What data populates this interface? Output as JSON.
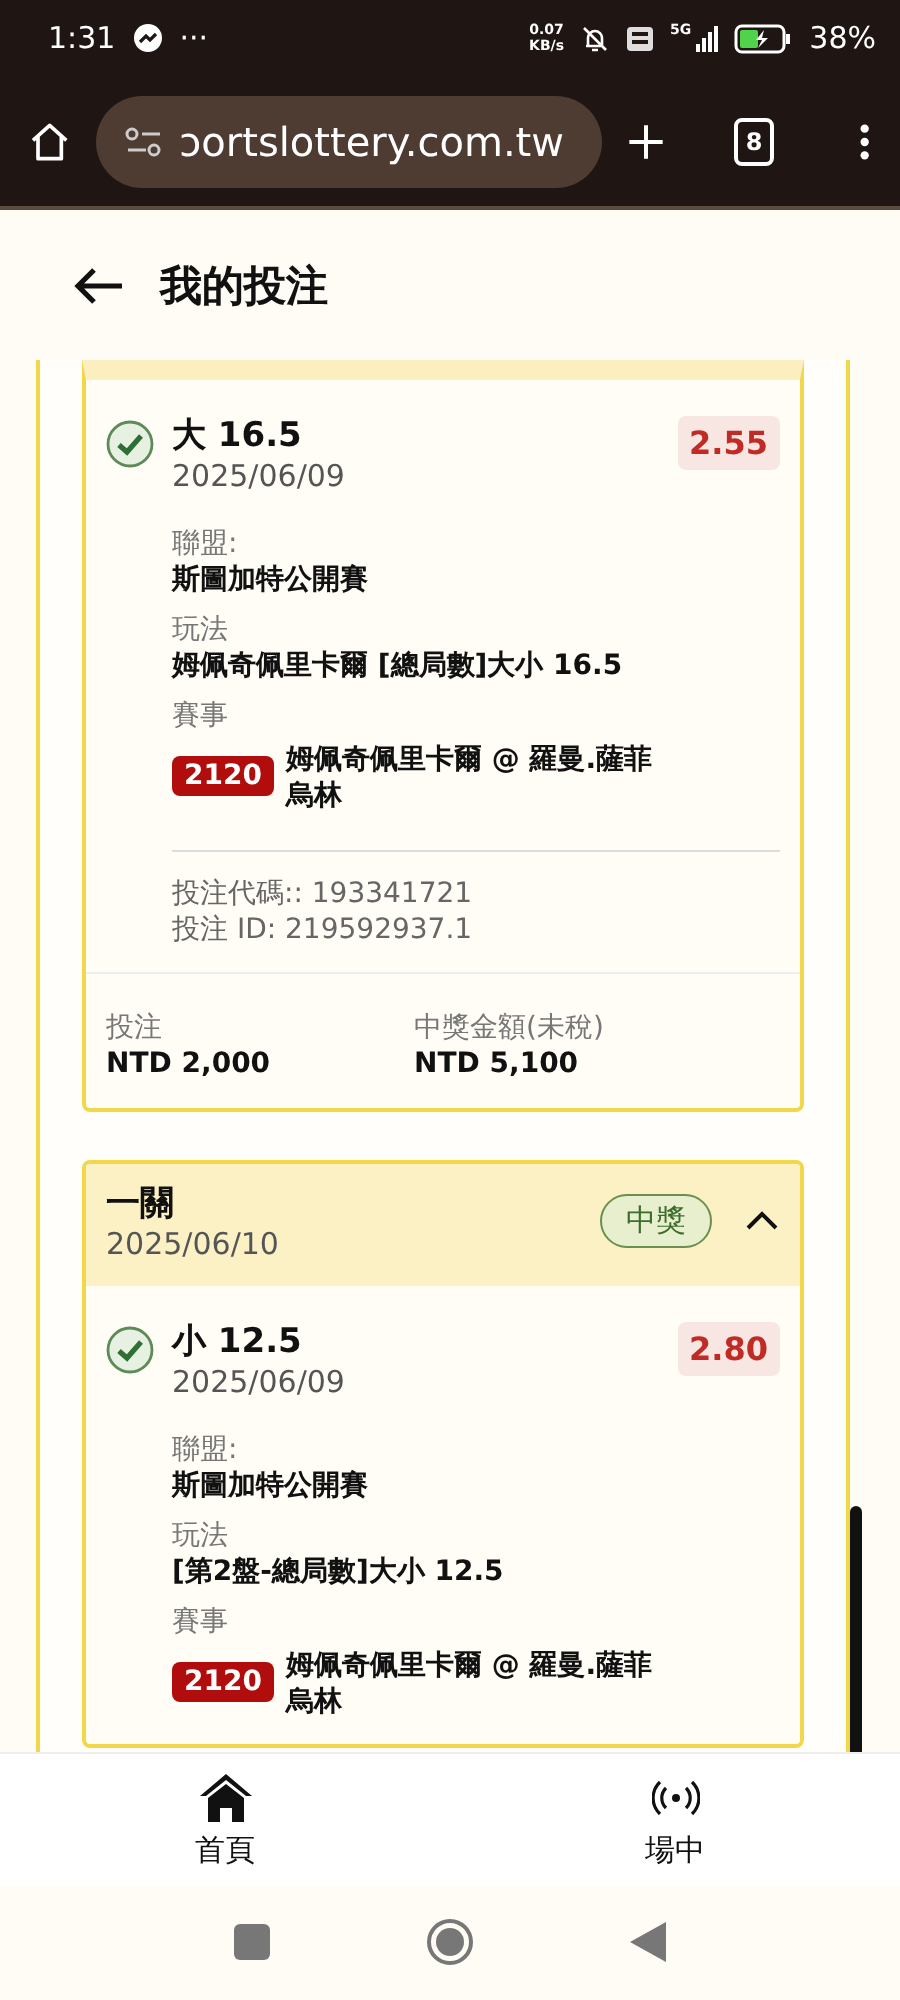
{
  "status_bar": {
    "time": "1:31",
    "more": "···",
    "speed": "0.07",
    "speed_unit": "KB/s",
    "network": "5G",
    "battery": "38%"
  },
  "browser": {
    "url": "ɔortslottery.com.tw",
    "tab_count": "8"
  },
  "header": {
    "title": "我的投注"
  },
  "bets": [
    {
      "legs": [
        {
          "kind": "won",
          "selection": "大 16.5",
          "date": "2025/06/09",
          "odds": "2.55",
          "league_label": "聯盟:",
          "league": "斯圖加特公開賽",
          "play_label": "玩法",
          "play": "姆佩奇佩里卡爾 [總局數]大小 16.5",
          "event_label": "賽事",
          "event_no": "2120",
          "event": "姆佩奇佩里卡爾 @ 羅曼.薩菲烏林",
          "codes": [
            "投注代碼:: 193341721",
            "投注 ID: 219592937.1"
          ]
        }
      ],
      "stake_label": "投注",
      "stake": "NTD 2,000",
      "payout_label": "中獎金額(未稅)",
      "payout": "NTD 5,100"
    },
    {
      "header": {
        "title": "一關",
        "date": "2025/06/10",
        "status": "中獎",
        "expanded": true
      },
      "legs": [
        {
          "kind": "won",
          "selection": "小 12.5",
          "date": "2025/06/09",
          "odds": "2.80",
          "league_label": "聯盟:",
          "league": "斯圖加特公開賽",
          "play_label": "玩法",
          "play": "[第2盤-總局數]大小 12.5",
          "event_label": "賽事",
          "event_no": "2120",
          "event": "姆佩奇佩里卡爾 @ 羅曼.薩菲烏林"
        }
      ]
    }
  ],
  "bottom_nav": [
    {
      "kind": "home",
      "label": "首頁"
    },
    {
      "kind": "live",
      "label": "場中"
    }
  ]
}
